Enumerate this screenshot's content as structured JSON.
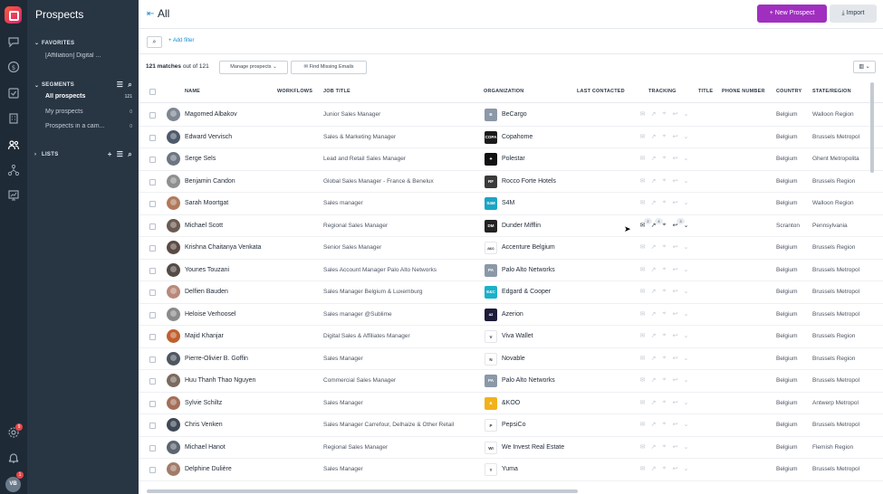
{
  "rail": {
    "icons": [
      "chat-icon",
      "dollar-icon",
      "checkbox-icon",
      "building-icon",
      "people-icon",
      "sitemap-icon",
      "chart-icon"
    ],
    "active": "people-icon",
    "badge_settings": "9",
    "badge_avatar": "1",
    "avatar_initials": "VB"
  },
  "nav": {
    "title": "Prospects",
    "favorites_label": "FAVORITES",
    "favorites": [
      {
        "label": "[Affiliation] Digital ..."
      }
    ],
    "segments_label": "SEGMENTS",
    "segments": [
      {
        "label": "All prospects",
        "count": "121"
      },
      {
        "label": "My prospects",
        "count": "0"
      },
      {
        "label": "Prospects in a cam...",
        "count": "0"
      }
    ],
    "lists_label": "LISTS"
  },
  "header": {
    "title": "All",
    "new_prospect": "+ New Prospect",
    "import": "Import"
  },
  "filters": {
    "add_filter": "+ Add filter"
  },
  "toolbar": {
    "matches_count": "121 matches",
    "matches_total": " out of 121",
    "manage": "Manage prospects",
    "find_emails": "Find Missing Emails"
  },
  "columns": [
    "NAME",
    "WORKFLOWS",
    "JOB TITLE",
    "ORGANIZATION",
    "LAST CONTACTED",
    "TRACKING",
    "TITLE",
    "PHONE NUMBER",
    "COUNTRY",
    "STATE/REGION"
  ],
  "colors": {
    "accent": "#a02fc0",
    "link": "#1a8fd1",
    "sidebar": "#283543",
    "rail": "#1e2a36"
  },
  "rows": [
    {
      "name": "Magomed Albakov",
      "job": "Junior Sales Manager",
      "org": "BeCargo",
      "logo": "B",
      "logo_color": "#8b98a8",
      "country": "Belgium",
      "region": "Walloon Region",
      "avatar_color": "#7d8691"
    },
    {
      "name": "Edward Vervisch",
      "job": "Sales & Marketing Manager",
      "org": "Copahome",
      "logo": "COPA",
      "logo_color": "#1b1b1b",
      "country": "Belgium",
      "region": "Brussels Metropol",
      "avatar_color": "#4d5a6a"
    },
    {
      "name": "Serge Sels",
      "job": "Lead and Retail Sales Manager",
      "org": "Polestar",
      "logo": "✦",
      "logo_color": "#111111",
      "country": "Belgium",
      "region": "Ghent Metropolita",
      "avatar_color": "#6c7682"
    },
    {
      "name": "Benjamin Candon",
      "job": "Global Sales Manager - France & Benelux",
      "org": "Rocco Forte Hotels",
      "logo": "RF",
      "logo_color": "#3a3a3a",
      "country": "Belgium",
      "region": "Brussels Region",
      "avatar_color": "#8f8f8f"
    },
    {
      "name": "Sarah Moortgat",
      "job": "Sales manager",
      "org": "S4M",
      "logo": "S4M",
      "logo_color": "#1aa5c5",
      "country": "Belgium",
      "region": "Walloon Region",
      "avatar_color": "#b07a5c"
    },
    {
      "name": "Michael Scott",
      "job": "Regional Sales Manager",
      "org": "Dunder Mifflin",
      "logo": "DM",
      "logo_color": "#222222",
      "country": "Scranton",
      "region": "Pennsylvania",
      "avatar_color": "#6a5a52"
    },
    {
      "name": "Krishna Chaitanya Venkata",
      "job": "Senior Sales Manager",
      "org": "Accenture Belgium",
      "logo": "acc",
      "logo_color": "#ffffff",
      "country": "Belgium",
      "region": "Brussels Region",
      "avatar_color": "#5b4a44"
    },
    {
      "name": "Younes Touzani",
      "job": "Sales Account Manager Palo Alto Networks",
      "org": "Palo Alto Networks",
      "logo": "PA",
      "logo_color": "#8b98a8",
      "country": "Belgium",
      "region": "Brussels Metropol",
      "avatar_color": "#544b46"
    },
    {
      "name": "Delfien Bauden",
      "job": "Sales Manager Belgium & Luxemburg",
      "org": "Edgard & Cooper",
      "logo": "E&C",
      "logo_color": "#1bb1c9",
      "country": "Belgium",
      "region": "Brussels Metropol",
      "avatar_color": "#b9897a"
    },
    {
      "name": "Heloise Verhoosel",
      "job": "Sales manager @Sublime",
      "org": "Azerion",
      "logo": "az",
      "logo_color": "#1c1c3a",
      "country": "Belgium",
      "region": "Brussels Metropol",
      "avatar_color": "#8a8a8a"
    },
    {
      "name": "Majid Khanjar",
      "job": "Digital Sales & Affiliates Manager",
      "org": "Viva Wallet",
      "logo": "V",
      "logo_color": "#ffffff",
      "country": "Belgium",
      "region": "Brussels Region",
      "avatar_color": "#c0602e"
    },
    {
      "name": "Pierre-Olivier B. Goffin",
      "job": "Sales Manager",
      "org": "Novable",
      "logo": "N",
      "logo_color": "#ffffff",
      "country": "Belgium",
      "region": "Brussels Region",
      "avatar_color": "#4e5660"
    },
    {
      "name": "Huu Thanh Thao Nguyen",
      "job": "Commercial Sales Manager",
      "org": "Palo Alto Networks",
      "logo": "PA",
      "logo_color": "#8b98a8",
      "country": "Belgium",
      "region": "Brussels Metropol",
      "avatar_color": "#7a6a5e"
    },
    {
      "name": "Sylvie Schiltz",
      "job": "Sales Manager",
      "org": "&KOO",
      "logo": "&",
      "logo_color": "#f2b21c",
      "country": "Belgium",
      "region": "Antwerp Metropol",
      "avatar_color": "#a46e58"
    },
    {
      "name": "Chris Venken",
      "job": "Sales Manager Carrefour, Delhaize & Other Retail",
      "org": "PepsiCo",
      "logo": "P",
      "logo_color": "#ffffff",
      "country": "Belgium",
      "region": "Brussels Metropol",
      "avatar_color": "#3f4955"
    },
    {
      "name": "Michael Hanot",
      "job": "Regional Sales Manager",
      "org": "We Invest Real Estate",
      "logo": "WI",
      "logo_color": "#ffffff",
      "country": "Belgium",
      "region": "Flemish Region",
      "avatar_color": "#5c6570"
    },
    {
      "name": "Delphine Dulière",
      "job": "Sales Manager",
      "org": "Yuma",
      "logo": "Y",
      "logo_color": "#ffffff",
      "country": "Belgium",
      "region": "Brussels Metropol",
      "avatar_color": "#a17c6b"
    }
  ],
  "hover_badges": [
    "2",
    "4",
    "3"
  ]
}
